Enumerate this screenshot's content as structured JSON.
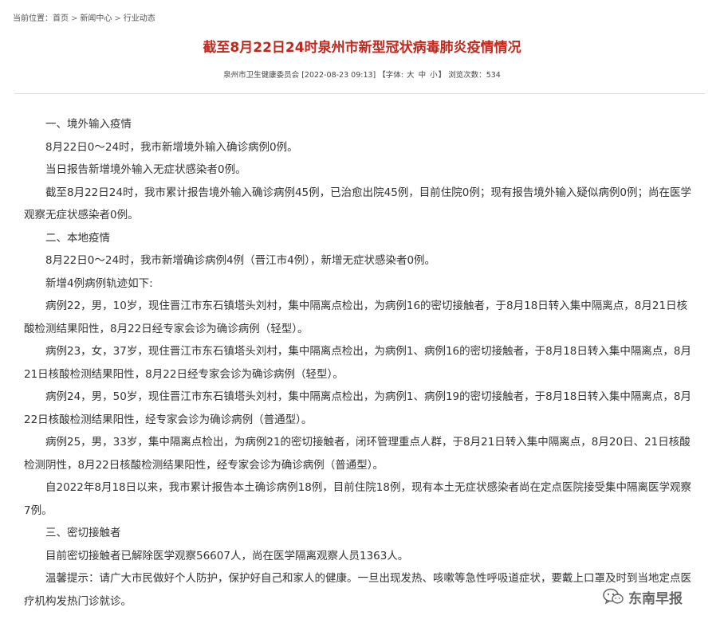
{
  "breadcrumb": {
    "prefix": "当前位置：",
    "items": [
      "首页",
      "新闻中心",
      "行业动态"
    ],
    "separator": ">"
  },
  "article": {
    "title": "截至8月22日24时泉州市新型冠状病毒肺炎疫情情况",
    "meta": {
      "source": "泉州市卫生健康委员会",
      "datetime": "[2022-08-23 09:13]",
      "font_label_open": "【字体:",
      "font_large": "大",
      "font_medium": "中",
      "font_small": "小",
      "font_label_close": "】",
      "views_label": "浏览次数：",
      "views": "534"
    },
    "paragraphs": [
      "一、境外输入疫情",
      "8月22日0～24时，我市新增境外输入确诊病例0例。",
      "当日报告新增境外输入无症状感染者0例。",
      "截至8月22日24时，我市累计报告境外输入确诊病例45例，已治愈出院45例，目前住院0例；现有报告境外输入疑似病例0例；尚在医学观察无症状感染者0例。",
      "二、本地疫情",
      "8月22日0～24时，我市新增确诊病例4例（晋江市4例），新增无症状感染者0例。",
      "新增4例病例轨迹如下:",
      "病例22，男，10岁，现住晋江市东石镇塔头刘村，集中隔离点检出，为病例16的密切接触者，于8月18日转入集中隔离点，8月21日核酸检测结果阳性，8月22日经专家会诊为确诊病例（轻型）。",
      "病例23，女，37岁，现住晋江市东石镇塔头刘村，集中隔离点检出，为病例1、病例16的密切接触者，于8月18日转入集中隔离点，8月21日核酸检测结果阳性，8月22日经专家会诊为确诊病例（轻型）。",
      "病例24，男，50岁，现住晋江市东石镇塔头刘村，集中隔离点检出，为病例1、病例19的密切接触者，于8月18日转入集中隔离点，8月22日核酸检测结果阳性，经专家会诊为确诊病例（普通型）。",
      "病例25，男，33岁，集中隔离点检出，为病例21的密切接触者，闭环管理重点人群，于8月21日转入集中隔离点，8月20日、21日核酸检测阴性，8月22日核酸检测结果阳性，经专家会诊为确诊病例（普通型）。",
      "自2022年8月18日以来，我市累计报告本土确诊病例18例，目前住院18例，现有本土无症状感染者尚在定点医院接受集中隔离医学观察7例。",
      "三、密切接触者",
      "目前密切接触者已解除医学观察56607人，尚在医学隔离观察人员1363人。",
      "温馨提示：请广大市民做好个人防护，保护好自己和家人的健康。一旦出现发热、咳嗽等急性呼吸道症状，要戴上口罩及时到当地定点医疗机构发热门诊就诊。"
    ]
  },
  "watermark": {
    "icon": "wechat-icon",
    "text": "东南早报"
  },
  "colors": {
    "title": "#c0281e",
    "body_text": "#333333",
    "divider": "#dcdcdc"
  }
}
